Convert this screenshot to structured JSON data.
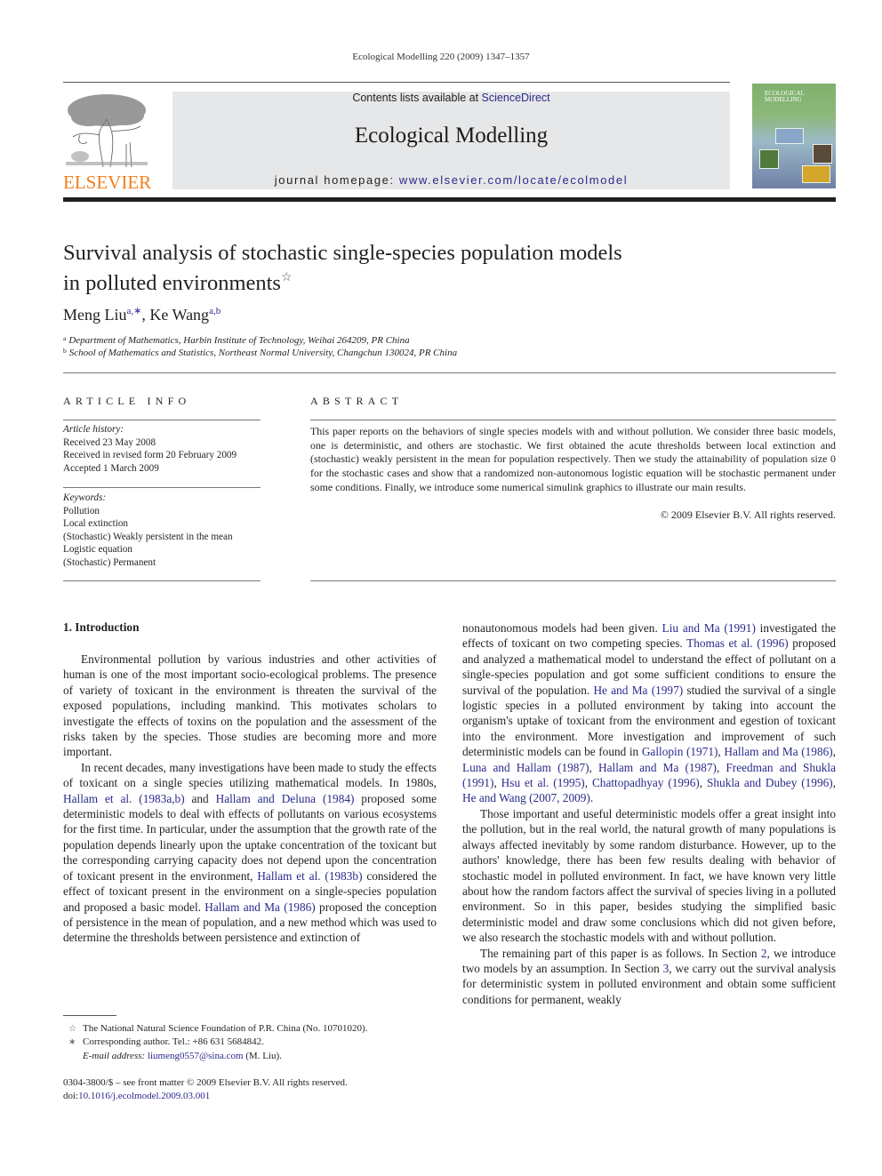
{
  "running_head": "Ecological Modelling 220 (2009) 1347–1357",
  "publisher": {
    "name": "ELSEVIER",
    "color": "#f07f1e"
  },
  "banner": {
    "contents_prefix": "Contents lists available at ",
    "contents_link": "ScienceDirect",
    "journal_title": "Ecological Modelling",
    "homepage_prefix": "journal homepage: ",
    "homepage_link": "www.elsevier.com/locate/ecolmodel"
  },
  "cover": {
    "line1": "ECOLOGICAL",
    "line2": "MODELLING"
  },
  "article": {
    "title_line1": "Survival analysis of stochastic single-species population models",
    "title_line2": "in polluted environments",
    "title_mark": "☆",
    "authors": [
      {
        "name": "Meng Liu",
        "sup": "a,∗"
      },
      {
        "name": "Ke Wang",
        "sup": "a,b"
      }
    ],
    "author_separator": ", ",
    "affiliations": [
      {
        "mark": "a",
        "text": "Department of Mathematics, Harbin Institute of Technology, Weihai 264209, PR China"
      },
      {
        "mark": "b",
        "text": "School of Mathematics and Statistics, Northeast Normal University, Changchun 130024, PR China"
      }
    ]
  },
  "article_info": {
    "heading": "ARTICLE INFO",
    "history_label": "Article history:",
    "history": [
      "Received 23 May 2008",
      "Received in revised form 20 February 2009",
      "Accepted 1 March 2009"
    ],
    "keywords_label": "Keywords:",
    "keywords": [
      "Pollution",
      "Local extinction",
      "(Stochastic) Weakly persistent in the mean",
      "Logistic equation",
      "(Stochastic) Permanent"
    ]
  },
  "abstract": {
    "heading": "ABSTRACT",
    "text": "This paper reports on the behaviors of single species models with and without pollution. We consider three basic models, one is deterministic, and others are stochastic. We first obtained the acute thresholds between local extinction and (stochastic) weakly persistent in the mean for population respectively. Then we study the attainability of population size 0 for the stochastic cases and show that a randomized non-autonomous logistic equation will be stochastic permanent under some conditions. Finally, we introduce some numerical simulink graphics to illustrate our main results.",
    "copyright": "© 2009 Elsevier B.V. All rights reserved."
  },
  "body": {
    "section_heading": "1.  Introduction",
    "left_p1": "Environmental pollution by various industries and other activities of human is one of the most important socio-ecological problems. The presence of variety of toxicant in the environment is threaten the survival of the exposed populations, including mankind. This motivates scholars to investigate the effects of toxins on the population and the assessment of the risks taken by the species. Those studies are becoming more and more important.",
    "left_p2": {
      "t1": "In recent decades, many investigations have been made to study the effects of toxicant on a single species utilizing mathematical models. In 1980s, ",
      "l1": "Hallam et al. (1983a,b)",
      "t2": " and ",
      "l2": "Hallam and Deluna (1984)",
      "t3": " proposed some deterministic models to deal with effects of pollutants on various ecosystems for the first time. In particular, under the assumption that the growth rate of the population depends linearly upon the uptake concentration of the toxicant but the corresponding carrying capacity does not depend upon the concentration of toxicant present in the environment, ",
      "l3": "Hallam et al. (1983b)",
      "t4": " considered the effect of toxicant present in the environment on a single-species population and proposed a basic model. ",
      "l4": "Hallam and Ma (1986)",
      "t5": " proposed the conception of persistence in the mean of population, and a new method which was used to determine the thresholds between persistence and extinction of"
    },
    "right_p1": {
      "t1": "nonautonomous models had been given. ",
      "l1": "Liu and Ma (1991)",
      "t2": " investigated the effects of toxicant on two competing species. ",
      "l2": "Thomas et al. (1996)",
      "t3": " proposed and analyzed a mathematical model to understand the effect of pollutant on a single-species population and got some sufficient conditions to ensure the survival of the population. ",
      "l3": "He and Ma (1997)",
      "t4": " studied the survival of a single logistic species in a polluted environment by taking into account the organism's uptake of toxicant from the environment and egestion of toxicant into the environment. More investigation and improvement of such deterministic models can be found in ",
      "l4": "Gallopin (1971)",
      "t5": ", ",
      "l5": "Hallam and Ma (1986)",
      "t6": ", ",
      "l6": "Luna and Hallam (1987)",
      "t7": ", ",
      "l7": "Hallam and Ma (1987)",
      "t8": ", ",
      "l8": "Freedman and Shukla (1991)",
      "t9": ", ",
      "l9": "Hsu et al. (1995)",
      "t10": ", ",
      "l10": "Chattopadhyay (1996)",
      "t11": ", ",
      "l11": "Shukla and Dubey (1996)",
      "t12": ", ",
      "l12": "He and Wang (2007, 2009)",
      "t13": "."
    },
    "right_p2": "Those important and useful deterministic models offer a great insight into the pollution, but in the real world, the natural growth of many populations is always affected inevitably by some random disturbance. However, up to the authors' knowledge, there has been few results dealing with behavior of stochastic model in polluted environment. In fact, we have known very little about how the random factors affect the survival of species living in a polluted environment. So in this paper, besides studying the simplified basic deterministic model and draw some conclusions which did not given before, we also research the stochastic models with and without pollution.",
    "right_p3": {
      "t1": "The remaining part of this paper is as follows. In Section ",
      "l1": "2",
      "t2": ", we introduce two models by an assumption. In Section ",
      "l2": "3",
      "t3": ", we carry out the survival analysis for deterministic system in polluted environment and obtain some sufficient conditions for permanent, weakly"
    }
  },
  "footnotes": {
    "funding_mark": "☆",
    "funding": "The National Natural Science Foundation of P.R. China (No. 10701020).",
    "corr_mark": "∗",
    "corresponding": "Corresponding author. Tel.: +86 631 5684842.",
    "email_label": "E-mail address: ",
    "email": "liumeng0557@sina.com",
    "email_suffix": " (M. Liu).",
    "front_matter": "0304-3800/$ – see front matter © 2009 Elsevier B.V. All rights reserved.",
    "doi_label": "doi:",
    "doi": "10.1016/j.ecolmodel.2009.03.001"
  },
  "colors": {
    "link": "#2a2a8c",
    "banner_bg": "#e6e7e8",
    "text": "#231f20"
  }
}
